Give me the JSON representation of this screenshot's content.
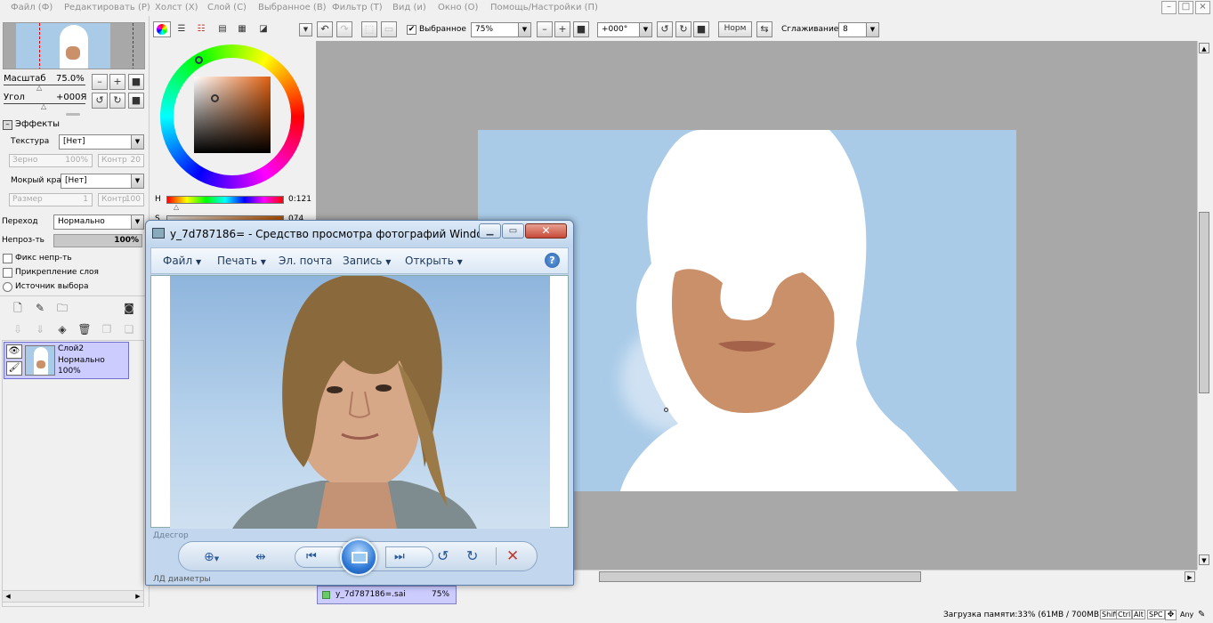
{
  "menu": [
    "Файл (Ф)",
    "Редактировать (Р)",
    "Холст (Х)",
    "Слой (С)",
    "Выбранное (В)",
    "Фильтр (Т)",
    "Вид (и)",
    "Окно (О)",
    "Помощь/Настройки (П)"
  ],
  "navigator": {
    "zoom_label": "Масштаб",
    "zoom_value": "75.0%",
    "angle_label": "Угол",
    "angle_value": "+000Я"
  },
  "effects": {
    "title": "Эффекты",
    "texture_label": "Текстура",
    "texture_value": "[Нет]",
    "grain": "Зерно",
    "grain_value": "100%",
    "contrast": "Контр",
    "contrast_value": "20",
    "wet_label": "Мокрый край",
    "wet_value": "[Нет]",
    "size": "Размер",
    "size_value": "1",
    "contrast2": "Контр",
    "contrast2_value": "100"
  },
  "layer_props": {
    "blend_label": "Переход",
    "blend_value": "Нормально",
    "opacity_label": "Непроз-ть",
    "opacity_value": "100%",
    "opacity_fraction": 1.0,
    "fix_opacity": "Фикс непр-ть",
    "clip_layer": "Прикрепление слоя",
    "selection_source": "Источник выбора"
  },
  "layer": {
    "name": "Слой2",
    "mode": "Нормально",
    "opacity": "100%"
  },
  "color": {
    "h_label": "H",
    "h_value": "0:121",
    "s_label": "S",
    "s_value": "074"
  },
  "toolbar": {
    "selection_checkbox": "Выбранное",
    "zoom_select": "75%",
    "angle_select": "+000°",
    "norm_button": "Норм",
    "smoothing_label": "Сглаживание",
    "smoothing_value": "8"
  },
  "document_tab": {
    "name": "y_7d787186=.sai",
    "zoom": "75%"
  },
  "status": {
    "memory": "Загрузка памяти:33% (61MB / 700MB)",
    "keys": [
      "Shift",
      "Ctrl",
      "Alt",
      "SPC"
    ],
    "any": "Any"
  },
  "photo_viewer": {
    "title": "y_7d787186= - Средство просмотра фотографий Windows",
    "menu": [
      "Файл",
      "Печать",
      "Эл. почта",
      "Запись",
      "Открыть"
    ],
    "help_icon_glyph": "?",
    "behind_text": [
      "Ддесгор",
      "ЛД диаметры"
    ]
  },
  "colors": {
    "canvas_bg": "#a8a8a8",
    "sky": "#a9cbe8",
    "skin": "#c9906a",
    "layer_selected": "#ccccff",
    "viewer_chrome": "#c2d7ed",
    "close_red": "#c74a3a"
  },
  "icons": {
    "photo_controls": [
      "zoom-icon",
      "fit-icon",
      "previous-icon",
      "slideshow-icon",
      "next-icon",
      "rotate-left-icon",
      "rotate-right-icon",
      "delete-icon"
    ]
  }
}
